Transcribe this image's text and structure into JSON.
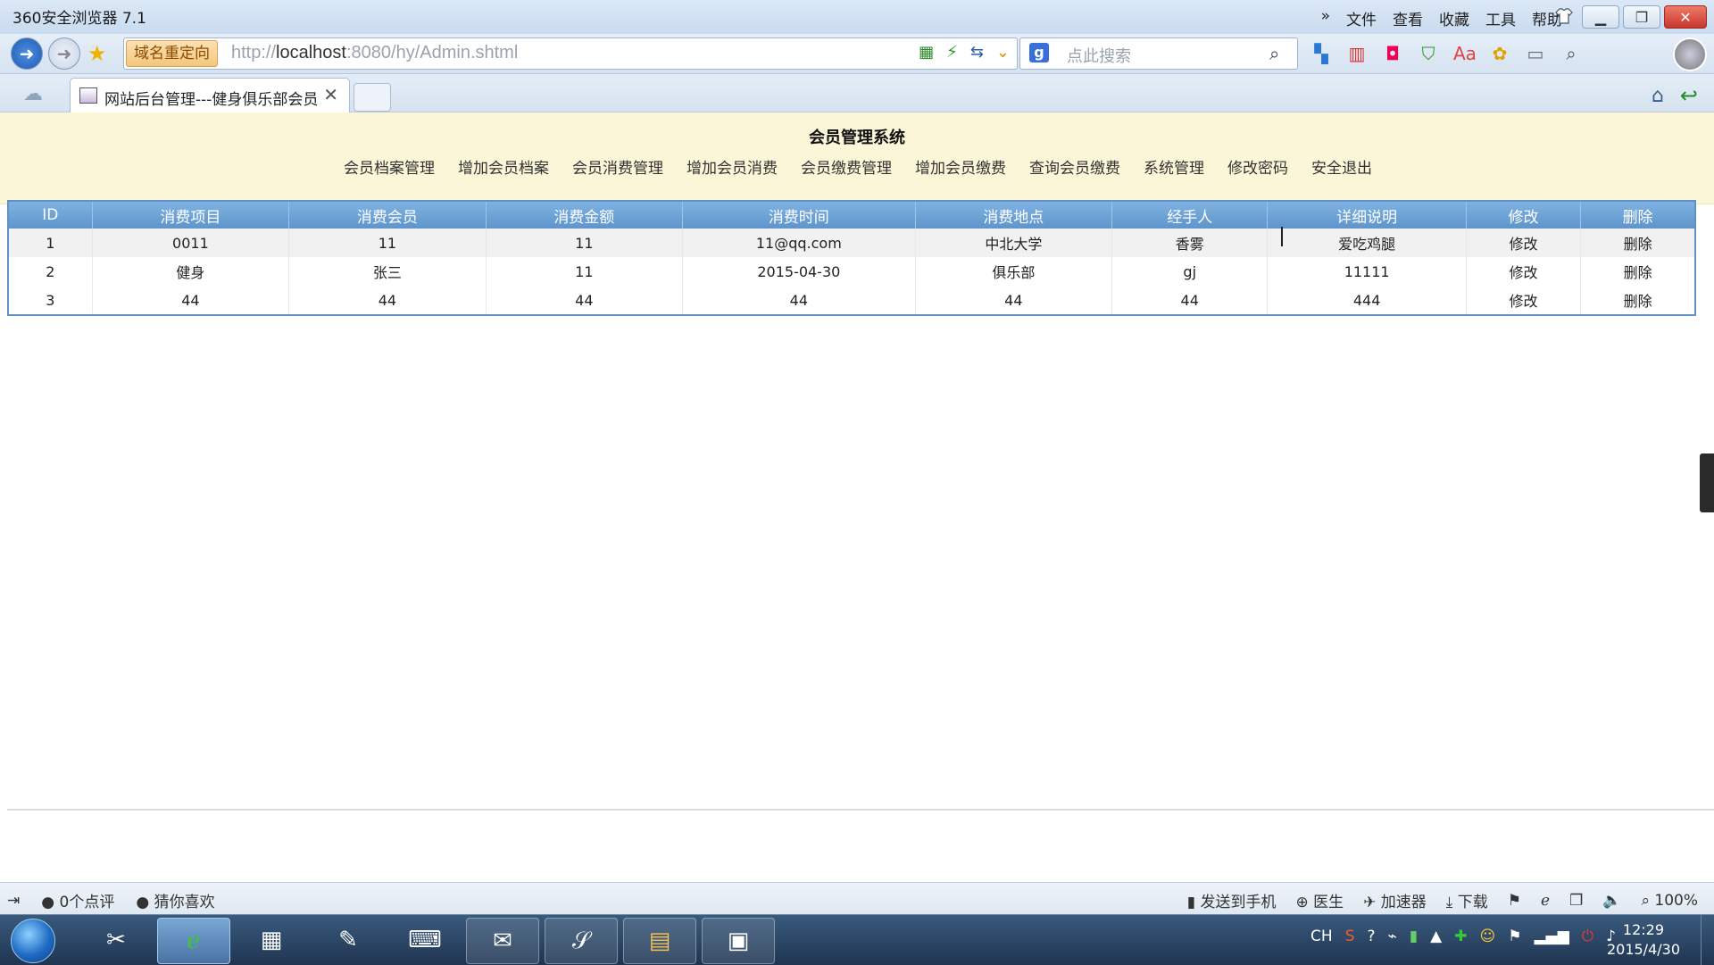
{
  "browser": {
    "title": "360安全浏览器 7.1",
    "menus": [
      "»",
      "文件",
      "查看",
      "收藏",
      "工具",
      "帮助"
    ],
    "redirect_label": "域名重定向",
    "url_prefix": "http://",
    "url_host": "localhost",
    "url_rest": ":8080/hy/Admin.shtml",
    "search_placeholder": "点此搜索",
    "tab_title": "网站后台管理---健身俱乐部会员"
  },
  "page": {
    "system_title": "会员管理系统",
    "nav": [
      "会员档案管理",
      "增加会员档案",
      "会员消费管理",
      "增加会员消费",
      "会员缴费管理",
      "增加会员缴费",
      "查询会员缴费",
      "系统管理",
      "修改密码",
      "安全退出"
    ]
  },
  "table": {
    "headers": [
      "ID",
      "消费项目",
      "消费会员",
      "消费金额",
      "消费时间",
      "消费地点",
      "经手人",
      "详细说明",
      "修改",
      "删除"
    ],
    "rows": [
      [
        "1",
        "0011",
        "11",
        "11",
        "11@qq.com",
        "中北大学",
        "香雾",
        "爱吃鸡腿",
        "修改",
        "删除"
      ],
      [
        "2",
        "健身",
        "张三",
        "11",
        "2015-04-30",
        "俱乐部",
        "gj",
        "11111",
        "修改",
        "删除"
      ],
      [
        "3",
        "44",
        "44",
        "44",
        "44",
        "44",
        "44",
        "444",
        "修改",
        "删除"
      ]
    ]
  },
  "statusbar": {
    "comments": "0个点评",
    "guess": "猜你喜欢",
    "send_to_phone": "发送到手机",
    "doctor": "医生",
    "accelerator": "加速器",
    "download": "下载",
    "zoom": "100%"
  },
  "taskbar": {
    "lang": "CH",
    "time": "12:29",
    "date": "2015/4/30"
  }
}
